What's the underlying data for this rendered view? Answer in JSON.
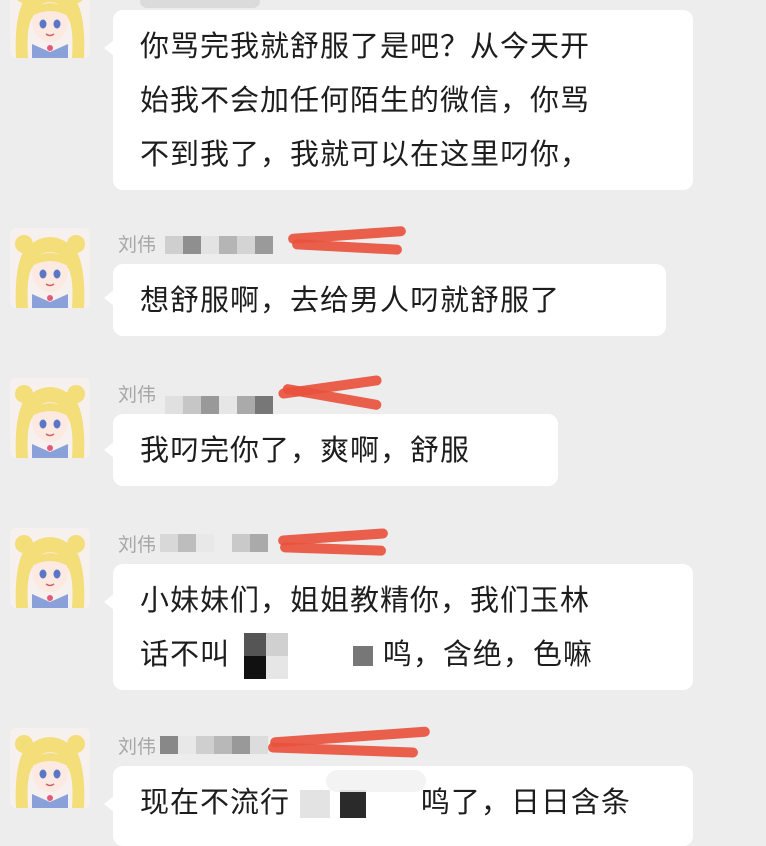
{
  "colors": {
    "background": "#ededed",
    "bubble": "#ffffff",
    "text": "#1d1d1d",
    "sender": "#a7a7a7",
    "redaction": "#e8533d"
  },
  "messages": [
    {
      "sender": "",
      "lines": [
        "你骂完我就舒服了是吧？从今天开",
        "始我不会加任何陌生的微信，你骂",
        "不到我了，我就可以在这里叼你，"
      ]
    },
    {
      "sender": "刘伟",
      "lines": [
        "想舒服啊，去给男人叼就舒服了"
      ]
    },
    {
      "sender": "刘伟",
      "lines": [
        "我叼完你了，爽啊，舒服"
      ]
    },
    {
      "sender": "刘伟",
      "lines": [
        "小妹妹们，姐姐教精你，我们玉林"
      ],
      "line2_prefix": "话不叫",
      "line2_suffix": "鸣，含绝，色嘛"
    },
    {
      "sender": "刘伟",
      "line1_prefix": "现在不流行",
      "line1_suffix": "鸣了，日日含条"
    }
  ]
}
